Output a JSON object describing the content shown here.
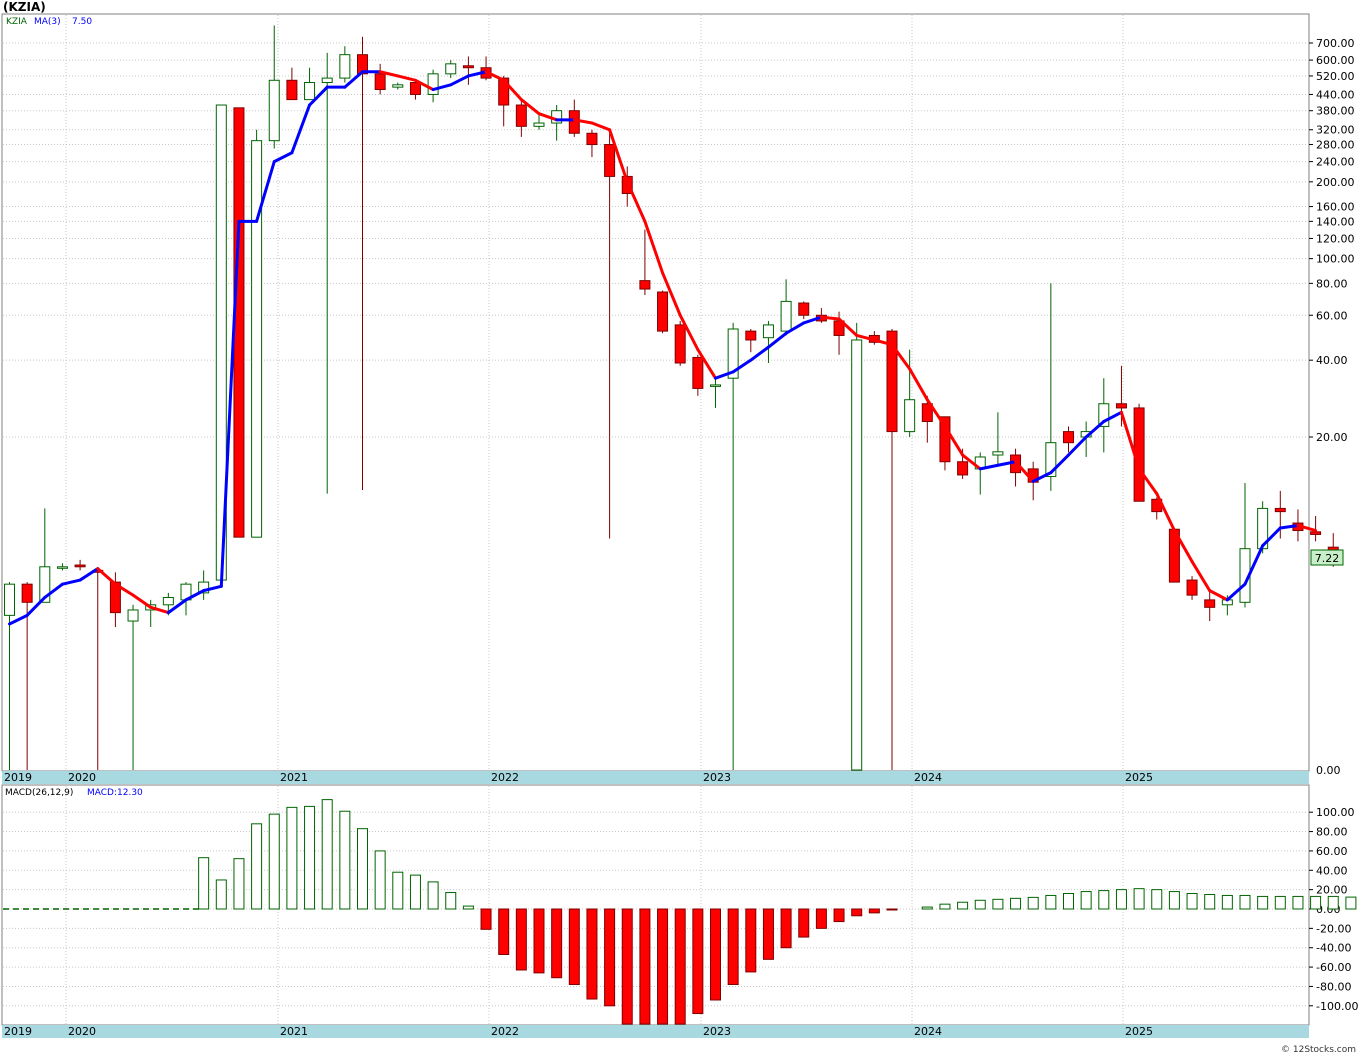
{
  "header": {
    "title": "(KZIA)"
  },
  "price_panel": {
    "indicator_label": "KZIA",
    "ma_label": "MA(3)",
    "ma_value": "7.50",
    "last_price": "7.22"
  },
  "macd_panel": {
    "label": "MACD(26,12,9)",
    "value_label": "MACD:12.30"
  },
  "footer": {
    "credit": "© 12Stocks.com"
  },
  "colors": {
    "up": "#006400",
    "down": "#ff0000",
    "ma_up": "#0000ff",
    "ma_down": "#ff0000",
    "axis_band": "#a8d8e0",
    "grid": "#c8c8c8"
  },
  "chart_data": [
    {
      "type": "candlestick",
      "title": "(KZIA)",
      "scale": "log",
      "x_tick_labels": [
        "2019",
        "2020",
        "2021",
        "2022",
        "2023",
        "2024",
        "2025"
      ],
      "y_tick_labels": [
        "700.00",
        "600.00",
        "520.00",
        "440.00",
        "380.00",
        "320.00",
        "280.00",
        "240.00",
        "200.00",
        "160.00",
        "140.00",
        "120.00",
        "100.00",
        "80.00",
        "60.00",
        "40.00",
        "20.00",
        "0.00"
      ],
      "y_ticks": [
        700,
        600,
        520,
        440,
        380,
        320,
        280,
        240,
        200,
        160,
        140,
        120,
        100,
        80,
        60,
        40,
        20
      ],
      "bottom_label_value": 0.1,
      "last_price": 7.22,
      "bars": [
        {
          "date": "2019-11",
          "o": 4.0,
          "h": 5.4,
          "l": 0.1,
          "c": 5.3
        },
        {
          "date": "2019-12",
          "o": 5.3,
          "h": 5.4,
          "l": 0.1,
          "c": 4.5
        },
        {
          "date": "2020-01",
          "o": 4.5,
          "h": 10.5,
          "l": 4.5,
          "c": 6.2
        },
        {
          "date": "2020-02",
          "o": 6.2,
          "h": 6.4,
          "l": 6.0,
          "c": 6.2
        },
        {
          "date": "2020-03",
          "o": 6.3,
          "h": 6.6,
          "l": 6.0,
          "c": 6.2
        },
        {
          "date": "2020-04",
          "o": 6.0,
          "h": 6.1,
          "l": 0.1,
          "c": 5.9
        },
        {
          "date": "2020-05",
          "o": 5.4,
          "h": 5.9,
          "l": 3.6,
          "c": 4.1
        },
        {
          "date": "2020-06",
          "o": 3.8,
          "h": 4.4,
          "l": 0.1,
          "c": 4.2
        },
        {
          "date": "2020-07",
          "o": 4.2,
          "h": 4.6,
          "l": 3.6,
          "c": 4.4
        },
        {
          "date": "2020-08",
          "o": 4.4,
          "h": 4.9,
          "l": 4.0,
          "c": 4.7
        },
        {
          "date": "2020-09",
          "o": 4.6,
          "h": 5.4,
          "l": 4.0,
          "c": 5.3
        },
        {
          "date": "2020-10",
          "o": 4.9,
          "h": 6.0,
          "l": 4.6,
          "c": 5.4
        },
        {
          "date": "2020-11",
          "o": 5.5,
          "h": 400,
          "l": 5.4,
          "c": 400
        },
        {
          "date": "2020-12",
          "o": 390,
          "h": 390,
          "l": 8.1,
          "c": 8.1
        },
        {
          "date": "2021-01",
          "o": 8.1,
          "h": 320,
          "l": 8.1,
          "c": 290
        },
        {
          "date": "2021-02",
          "o": 290,
          "h": 820,
          "l": 270,
          "c": 500
        },
        {
          "date": "2021-03",
          "o": 500,
          "h": 560,
          "l": 420,
          "c": 420
        },
        {
          "date": "2021-04",
          "o": 420,
          "h": 560,
          "l": 420,
          "c": 490
        },
        {
          "date": "2021-05",
          "o": 490,
          "h": 640,
          "l": 12,
          "c": 510
        },
        {
          "date": "2021-06",
          "o": 510,
          "h": 680,
          "l": 490,
          "c": 630
        },
        {
          "date": "2021-07",
          "o": 630,
          "h": 740,
          "l": 12.4,
          "c": 530
        },
        {
          "date": "2021-08",
          "o": 530,
          "h": 580,
          "l": 440,
          "c": 460
        },
        {
          "date": "2021-09",
          "o": 470,
          "h": 490,
          "l": 460,
          "c": 480
        },
        {
          "date": "2021-10",
          "o": 490,
          "h": 500,
          "l": 420,
          "c": 440
        },
        {
          "date": "2021-11",
          "o": 440,
          "h": 550,
          "l": 410,
          "c": 530
        },
        {
          "date": "2021-12",
          "o": 530,
          "h": 600,
          "l": 510,
          "c": 580
        },
        {
          "date": "2022-01",
          "o": 570,
          "h": 620,
          "l": 480,
          "c": 560
        },
        {
          "date": "2022-02",
          "o": 560,
          "h": 620,
          "l": 500,
          "c": 510
        },
        {
          "date": "2022-03",
          "o": 510,
          "h": 520,
          "l": 330,
          "c": 400
        },
        {
          "date": "2022-04",
          "o": 400,
          "h": 420,
          "l": 300,
          "c": 330
        },
        {
          "date": "2022-05",
          "o": 330,
          "h": 370,
          "l": 320,
          "c": 340
        },
        {
          "date": "2022-06",
          "o": 340,
          "h": 400,
          "l": 290,
          "c": 380
        },
        {
          "date": "2022-07",
          "o": 380,
          "h": 420,
          "l": 300,
          "c": 310
        },
        {
          "date": "2022-08",
          "o": 310,
          "h": 320,
          "l": 250,
          "c": 280
        },
        {
          "date": "2022-09",
          "o": 280,
          "h": 310,
          "l": 8.0,
          "c": 210
        },
        {
          "date": "2022-10",
          "o": 210,
          "h": 230,
          "l": 160,
          "c": 180
        },
        {
          "date": "2022-11",
          "o": 82,
          "h": 130,
          "l": 72,
          "c": 76
        },
        {
          "date": "2022-12",
          "o": 74,
          "h": 75,
          "l": 51,
          "c": 52
        },
        {
          "date": "2023-01",
          "o": 55,
          "h": 57,
          "l": 38,
          "c": 39
        },
        {
          "date": "2023-02",
          "o": 41,
          "h": 42,
          "l": 29,
          "c": 31
        },
        {
          "date": "2023-03",
          "o": 32,
          "h": 34,
          "l": 26,
          "c": 32
        },
        {
          "date": "2023-04",
          "o": 34,
          "h": 56,
          "l": 0.1,
          "c": 53
        },
        {
          "date": "2023-05",
          "o": 52,
          "h": 53,
          "l": 43,
          "c": 48
        },
        {
          "date": "2023-06",
          "o": 49,
          "h": 57,
          "l": 39,
          "c": 55
        },
        {
          "date": "2023-07",
          "o": 52,
          "h": 83,
          "l": 50,
          "c": 68
        },
        {
          "date": "2023-08",
          "o": 67,
          "h": 68,
          "l": 58,
          "c": 60
        },
        {
          "date": "2023-09",
          "o": 60,
          "h": 64,
          "l": 56,
          "c": 57
        },
        {
          "date": "2023-10",
          "o": 57,
          "h": 62,
          "l": 42,
          "c": 50
        },
        {
          "date": "2023-11",
          "o": 0.1,
          "h": 56,
          "l": 0.1,
          "c": 48
        },
        {
          "date": "2023-12",
          "o": 50,
          "h": 52,
          "l": 46,
          "c": 47
        },
        {
          "date": "2024-01",
          "o": 52,
          "h": 53,
          "l": 0.1,
          "c": 21
        },
        {
          "date": "2024-02",
          "o": 21,
          "h": 44,
          "l": 20,
          "c": 28
        },
        {
          "date": "2024-03",
          "o": 27,
          "h": 29,
          "l": 19,
          "c": 23
        },
        {
          "date": "2024-04",
          "o": 24,
          "h": 23,
          "l": 14.8,
          "c": 16
        },
        {
          "date": "2024-05",
          "o": 16,
          "h": 18,
          "l": 13.7,
          "c": 14.2
        },
        {
          "date": "2024-06",
          "o": 15,
          "h": 17.4,
          "l": 11.9,
          "c": 16.7
        },
        {
          "date": "2024-07",
          "o": 17,
          "h": 25,
          "l": 15.5,
          "c": 17.5
        },
        {
          "date": "2024-08",
          "o": 17,
          "h": 18,
          "l": 12.8,
          "c": 14.5
        },
        {
          "date": "2024-09",
          "o": 15,
          "h": 16,
          "l": 11.3,
          "c": 13.3
        },
        {
          "date": "2024-10",
          "o": 14,
          "h": 80,
          "l": 12.3,
          "c": 19
        },
        {
          "date": "2024-11",
          "o": 21,
          "h": 22,
          "l": 17.4,
          "c": 19
        },
        {
          "date": "2024-12",
          "o": 20,
          "h": 23,
          "l": 16.7,
          "c": 21
        },
        {
          "date": "2025-01",
          "o": 22,
          "h": 34,
          "l": 17.4,
          "c": 27
        },
        {
          "date": "2025-02",
          "o": 27,
          "h": 38,
          "l": 22,
          "c": 26
        },
        {
          "date": "2025-03",
          "o": 26,
          "h": 27,
          "l": 11.3,
          "c": 11.2
        },
        {
          "date": "2025-04",
          "o": 11.4,
          "h": 11.6,
          "l": 9.5,
          "c": 10.2
        },
        {
          "date": "2025-05",
          "o": 8.7,
          "h": 8.8,
          "l": 5.4,
          "c": 5.4
        },
        {
          "date": "2025-06",
          "o": 5.5,
          "h": 5.7,
          "l": 4.6,
          "c": 4.8
        },
        {
          "date": "2025-07",
          "o": 4.6,
          "h": 5.0,
          "l": 3.8,
          "c": 4.3
        },
        {
          "date": "2025-08",
          "o": 4.4,
          "h": 4.8,
          "l": 4.0,
          "c": 4.6
        },
        {
          "date": "2025-09",
          "o": 4.5,
          "h": 13.2,
          "l": 4.3,
          "c": 7.3
        },
        {
          "date": "2025-10",
          "o": 7.3,
          "h": 11.2,
          "l": 7.0,
          "c": 10.5
        },
        {
          "date": "2025-11",
          "o": 10.5,
          "h": 12.3,
          "l": 8.0,
          "c": 10.2
        },
        {
          "date": "2025-12",
          "o": 9.2,
          "h": 10.4,
          "l": 7.8,
          "c": 8.6
        },
        {
          "date": "2026-01",
          "o": 8.5,
          "h": 9.8,
          "l": 7.8,
          "c": 8.3
        },
        {
          "date": "2026-02",
          "o": 7.4,
          "h": 8.4,
          "l": 6.2,
          "c": 7.2
        }
      ],
      "ma3": [
        3.7,
        4.0,
        4.7,
        5.3,
        5.5,
        6.1,
        5.3,
        4.8,
        4.3,
        4.1,
        4.6,
        5.0,
        5.2,
        140,
        140,
        240,
        260,
        400,
        470,
        470,
        540,
        540,
        520,
        500,
        460,
        480,
        520,
        540,
        500,
        420,
        370,
        350,
        350,
        340,
        320,
        200,
        140,
        88,
        60,
        44,
        34,
        36,
        40,
        45,
        51,
        56,
        59,
        58,
        50,
        48,
        46,
        37,
        28,
        22,
        17,
        15,
        15.5,
        16,
        13.4,
        14.5,
        17,
        20,
        23,
        25,
        15,
        12,
        8.6,
        6.5,
        5.0,
        4.6,
        5.3,
        7.5,
        8.8,
        9.0,
        8.6
      ]
    },
    {
      "type": "bar",
      "title": "MACD(26,12,9)",
      "y_tick_labels": [
        "100.00",
        "80.00",
        "60.00",
        "40.00",
        "20.00",
        "0.00",
        "-20.00",
        "-40.00",
        "-60.00",
        "-80.00",
        "-100.00"
      ],
      "y_ticks": [
        100,
        80,
        60,
        40,
        20,
        0,
        -20,
        -40,
        -60,
        -80,
        -100
      ],
      "ylim": [
        -122,
        117
      ],
      "x_tick_labels": [
        "2019",
        "2020",
        "2021",
        "2022",
        "2023",
        "2024",
        "2025"
      ],
      "values": [
        0,
        0,
        0,
        0,
        0,
        0,
        0,
        0,
        0,
        0,
        0,
        53,
        30,
        52,
        88,
        98,
        105,
        106,
        113,
        101,
        83,
        60,
        38,
        35,
        28,
        17,
        3,
        -21,
        -47,
        -63,
        -66,
        -71,
        -78,
        -93,
        -100,
        -120,
        -125,
        -122,
        -119,
        -108,
        -94,
        -78,
        -65,
        -52,
        -40,
        -29,
        -20,
        -13,
        -7,
        -4,
        -1,
        0,
        2,
        5,
        7,
        9,
        10,
        11,
        12,
        14,
        16,
        18,
        19,
        20,
        21,
        20,
        18,
        16,
        15,
        14,
        14,
        13,
        13,
        13,
        13,
        13,
        12.3
      ]
    }
  ]
}
